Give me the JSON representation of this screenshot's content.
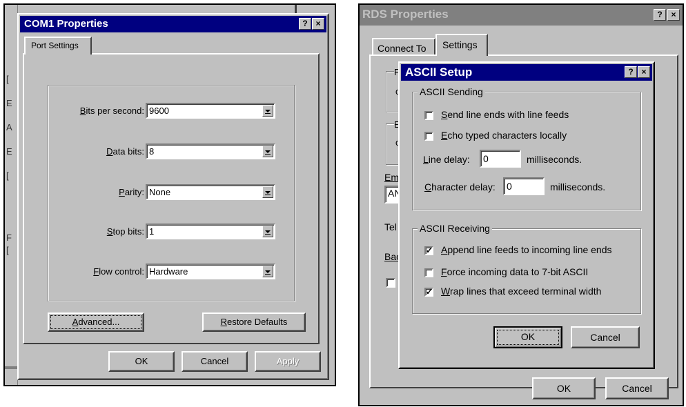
{
  "left_dialog": {
    "title": "COM1 Properties",
    "help_btn": "?",
    "close_btn": "×",
    "tab": "Port Settings",
    "rows": [
      {
        "key": "B",
        "rest": "its per second:",
        "value": "9600"
      },
      {
        "key": "D",
        "rest": "ata bits:",
        "value": "8"
      },
      {
        "key": "P",
        "rest": "arity:",
        "value": "None"
      },
      {
        "key": "S",
        "rest": "top bits:",
        "value": "1"
      },
      {
        "key": "F",
        "rest": "low control:",
        "value": "Hardware"
      }
    ],
    "advanced": {
      "key": "A",
      "rest": "dvanced..."
    },
    "restore": {
      "key": "R",
      "rest": "estore Defaults"
    },
    "ok": "OK",
    "cancel": "Cancel",
    "apply": "Apply"
  },
  "right_dialog": {
    "title": "RDS Properties",
    "help_btn": "?",
    "close_btn": "×",
    "tabs": [
      "Connect To",
      "Settings"
    ],
    "fragments": {
      "f1": "F",
      "c1": "c",
      "e1": "E",
      "c2": "c",
      "em": "Em",
      "an": "AN",
      "tel": "Tel",
      "bac": "Bac"
    },
    "ok": "OK",
    "cancel": "Cancel"
  },
  "ascii": {
    "title": "ASCII Setup",
    "help_btn": "?",
    "close_btn": "×",
    "sending_title": "ASCII Sending",
    "send_line_ends": {
      "key": "S",
      "rest": "end line ends with line feeds",
      "checked": false
    },
    "echo_typed": {
      "key": "E",
      "rest": "cho typed characters locally",
      "checked": false
    },
    "line_delay": {
      "key": "L",
      "rest": "ine delay:",
      "value": "0",
      "unit": "milliseconds."
    },
    "char_delay": {
      "key": "C",
      "rest": "haracter delay:",
      "value": "0",
      "unit": "milliseconds."
    },
    "receiving_title": "ASCII Receiving",
    "append_lf": {
      "key": "A",
      "rest": "ppend line feeds to incoming line ends",
      "checked": true
    },
    "force_7bit": {
      "key": "F",
      "rest": "orce incoming data to 7-bit ASCII",
      "checked": false
    },
    "wrap_lines": {
      "key": "W",
      "rest": "rap lines that exceed terminal width",
      "checked": true
    },
    "ok": "OK",
    "cancel": "Cancel",
    "check_mark": "✓"
  }
}
